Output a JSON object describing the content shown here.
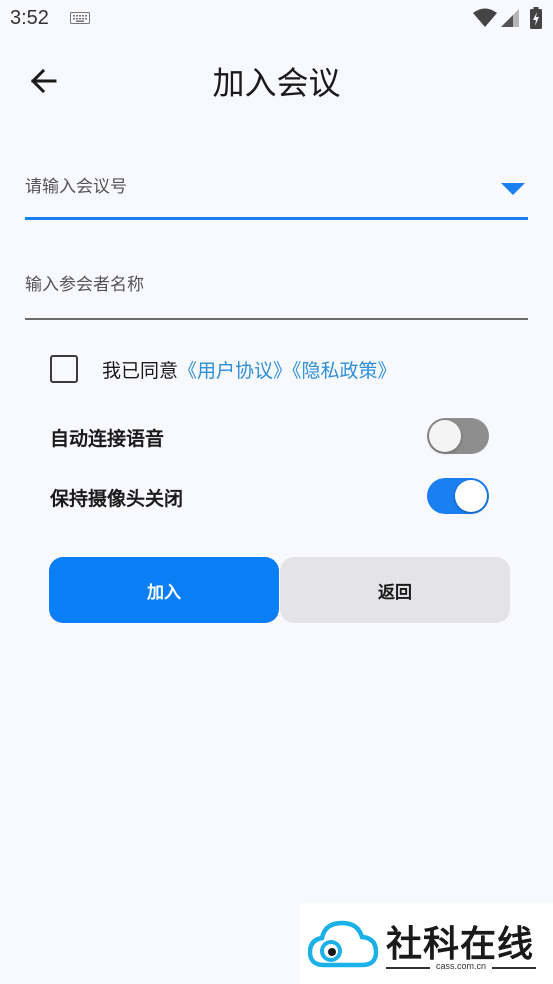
{
  "status_bar": {
    "time": "3:52"
  },
  "header": {
    "title": "加入会议"
  },
  "form": {
    "meeting_number_placeholder": "请输入会议号",
    "meeting_number_value": "",
    "participant_name_placeholder": "输入参会者名称",
    "participant_name_value": ""
  },
  "agreement": {
    "prefix": "我已同意",
    "user_agreement": "《用户协议》",
    "privacy_policy": "《隐私政策》",
    "checked": false
  },
  "settings": {
    "auto_voice_label": "自动连接语音",
    "auto_voice_on": false,
    "camera_off_label": "保持摄像头关闭",
    "camera_off_on": true
  },
  "buttons": {
    "join_label": "加入",
    "back_label": "返回"
  },
  "watermark": {
    "name": "社科在线",
    "domain": "cass.com.cn"
  },
  "colors": {
    "accent": "#1a7ff0",
    "primary_button": "#0a7ff5",
    "secondary_button": "#e4e4e8",
    "link": "#2d8fd8",
    "background": "#f8f8ff"
  }
}
